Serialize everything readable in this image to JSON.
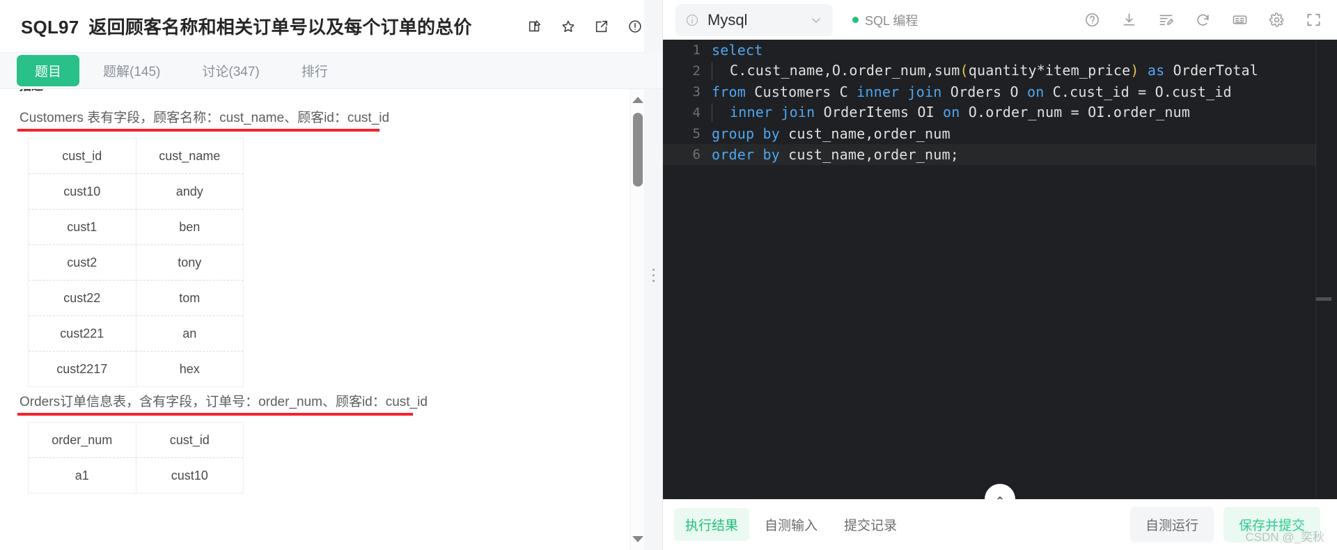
{
  "problem": {
    "code": "SQL97",
    "title": "返回顾客名称和相关订单号以及每个订单的总价",
    "header_icons": [
      "edit-icon",
      "star-icon",
      "share-icon",
      "report-icon"
    ]
  },
  "tabs": [
    {
      "label": "题目",
      "active": true
    },
    {
      "label": "题解(145)",
      "active": false
    },
    {
      "label": "讨论(347)",
      "active": false
    },
    {
      "label": "排行",
      "active": false
    }
  ],
  "description": {
    "heading": "描述",
    "para1": "Customers 表有字段，顾客名称：cust_name、顾客id：cust_id",
    "para2": "Orders订单信息表，含有字段，订单号：order_num、顾客id：cust_id",
    "table1": {
      "columns": [
        "cust_id",
        "cust_name"
      ],
      "rows": [
        [
          "cust10",
          "andy"
        ],
        [
          "cust1",
          "ben"
        ],
        [
          "cust2",
          "tony"
        ],
        [
          "cust22",
          "tom"
        ],
        [
          "cust221",
          "an"
        ],
        [
          "cust2217",
          "hex"
        ]
      ]
    },
    "table2": {
      "columns": [
        "order_num",
        "cust_id"
      ],
      "rows": [
        [
          "a1",
          "cust10"
        ]
      ]
    }
  },
  "editor": {
    "db_name": "Mysql",
    "mode_label": "SQL 编程",
    "toolbar_icons": [
      "help-icon",
      "download-icon",
      "format-icon",
      "refresh-icon",
      "keyboard-icon",
      "settings-icon",
      "fullscreen-icon"
    ],
    "lines": [
      {
        "n": "1",
        "current": false,
        "indent": 0,
        "tokens": [
          {
            "t": "select",
            "c": "kw"
          }
        ]
      },
      {
        "n": "2",
        "current": false,
        "indent": 1,
        "tokens": [
          {
            "t": "C.cust_name,O.order_num,sum",
            "c": "plain"
          },
          {
            "t": "(",
            "c": "paren"
          },
          {
            "t": "quantity*item_price",
            "c": "plain"
          },
          {
            "t": ")",
            "c": "paren"
          },
          {
            "t": " ",
            "c": "plain"
          },
          {
            "t": "as",
            "c": "kw"
          },
          {
            "t": " OrderTotal",
            "c": "plain"
          }
        ]
      },
      {
        "n": "3",
        "current": false,
        "indent": 0,
        "tokens": [
          {
            "t": "from",
            "c": "kw"
          },
          {
            "t": " Customers C ",
            "c": "plain"
          },
          {
            "t": "inner join",
            "c": "kw"
          },
          {
            "t": " Orders O ",
            "c": "plain"
          },
          {
            "t": "on",
            "c": "kw"
          },
          {
            "t": " C.cust_id = O.cust_id",
            "c": "plain"
          }
        ]
      },
      {
        "n": "4",
        "current": false,
        "indent": 1,
        "tokens": [
          {
            "t": "inner join",
            "c": "kw"
          },
          {
            "t": " OrderItems OI ",
            "c": "plain"
          },
          {
            "t": "on",
            "c": "kw"
          },
          {
            "t": " O.order_num = OI.order_num",
            "c": "plain"
          }
        ]
      },
      {
        "n": "5",
        "current": false,
        "indent": 0,
        "tokens": [
          {
            "t": "group by",
            "c": "kw"
          },
          {
            "t": " cust_name,order_num",
            "c": "plain"
          }
        ]
      },
      {
        "n": "6",
        "current": true,
        "indent": 0,
        "tokens": [
          {
            "t": "order by",
            "c": "kw"
          },
          {
            "t": " cust_name,order_num;",
            "c": "plain"
          }
        ]
      }
    ]
  },
  "bottom": {
    "tabs": [
      {
        "label": "执行结果",
        "active": true
      },
      {
        "label": "自测输入",
        "active": false
      },
      {
        "label": "提交记录",
        "active": false
      }
    ],
    "run_label": "自测运行",
    "submit_label": "保存并提交"
  },
  "watermark": "CSDN @_奕秋",
  "colors": {
    "accent_green": "#29c08a",
    "underline_red": "#f5222d",
    "editor_bg": "#1f2023",
    "keyword_blue": "#4fa6f0"
  }
}
